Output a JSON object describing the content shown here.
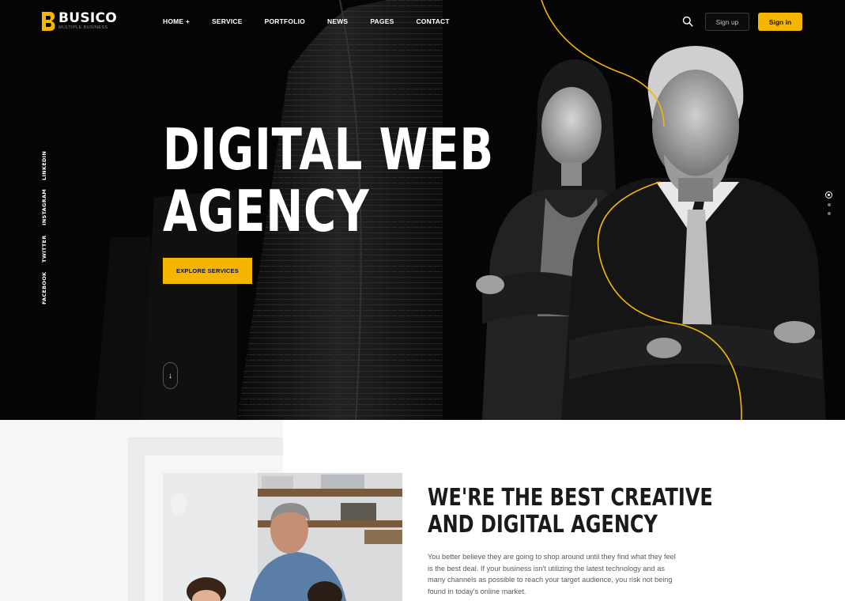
{
  "header": {
    "logo": {
      "name": "BUSICO",
      "tagline": "MULTIPLE BUSINESS"
    },
    "nav": [
      "HOME +",
      "SERVICE",
      "PORTFOLIO",
      "NEWS",
      "PAGES",
      "CONTACT"
    ],
    "signup_label": "Sign up",
    "signin_label": "Sign in"
  },
  "social": [
    "LINKEDIN",
    "INSTAGRAM",
    "TWITTER",
    "FACEBOOK"
  ],
  "hero": {
    "title_line1": "DIGITAL WEB",
    "title_line2": "AGENCY",
    "cta_label": "EXPLORE SERVICES",
    "scroll_glyph": "↓",
    "slides_total": 3,
    "slide_active": 1
  },
  "about": {
    "title_line1": "WE'RE THE BEST CREATIVE",
    "title_line2": "AND DIGITAL AGENCY",
    "text": "You better believe they are going to shop around until they find what they feel is the best deal. If your business isn't utilizing the latest technology and as many channels as possible to reach your target audience, you risk not being found in today's online market."
  },
  "colors": {
    "accent": "#f6b600",
    "hero_bg": "#050505",
    "text_dark": "#1a1a1a",
    "text_body": "#5a5a5a"
  }
}
